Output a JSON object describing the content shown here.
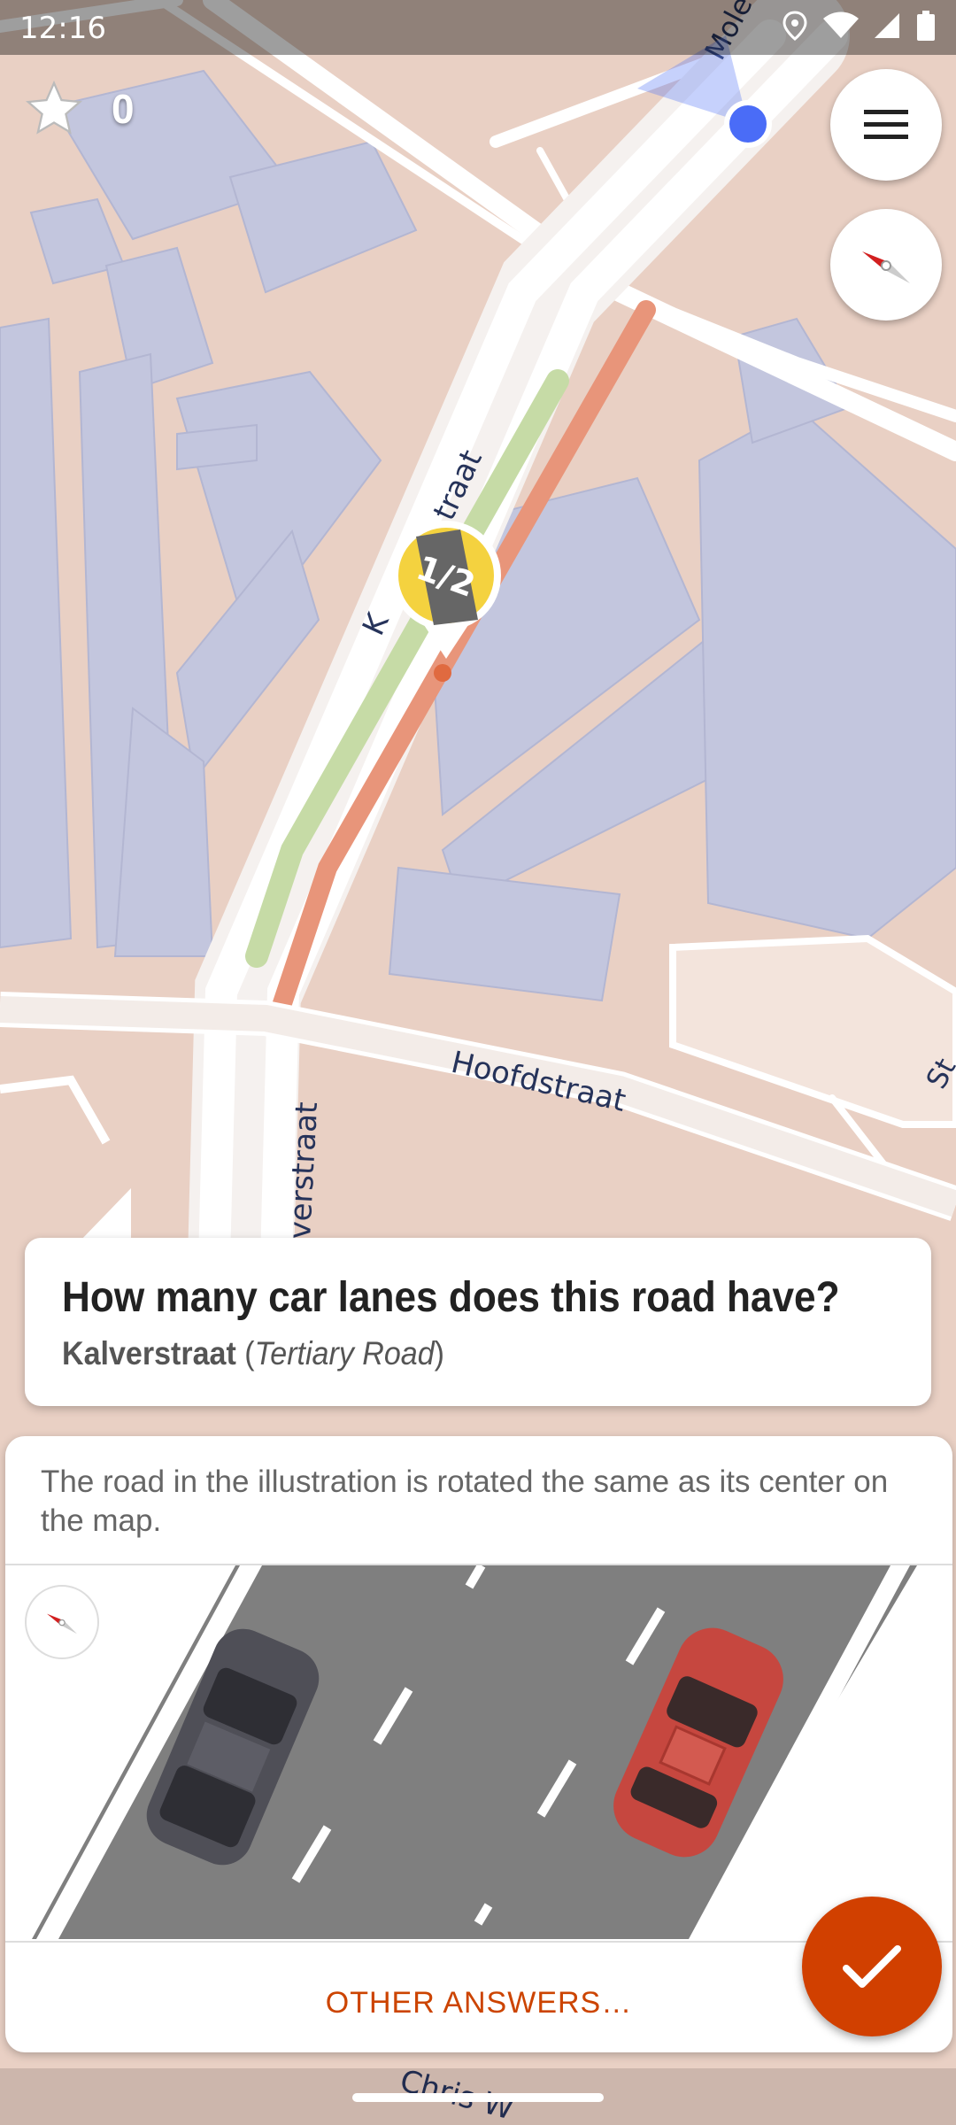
{
  "status_bar": {
    "time": "12:16",
    "icons": [
      "location-icon",
      "wifi-icon",
      "signal-icon",
      "battery-icon"
    ]
  },
  "map": {
    "streets": [
      "Kalverstraat",
      "Hoofdstraat",
      "Molenstraat",
      "Chris W"
    ],
    "label_k1": "K",
    "label_k2": "traat",
    "label_hoofd": "Hoofdstraat",
    "label_kalver_bottom": "verstraat",
    "label_mole": "Mole",
    "label_st": "St",
    "label_chris": "Chris W",
    "quest_pin_text": "1/2",
    "colors": {
      "land": "#e9d0c4",
      "building": "#c3c6de",
      "road": "#ffffff",
      "highlight": "#e8957a",
      "green": "#c6dba6"
    }
  },
  "stars": {
    "count": "0",
    "icon": "star-icon"
  },
  "quest": {
    "title": "How many car lanes does this road have?",
    "road_name": "Kalverstraat",
    "road_type": "Tertiary Road",
    "paren_open": " (",
    "paren_close": ")"
  },
  "answer": {
    "hint": "The road in the illustration is rotated the same as its center on the map.",
    "other_answers": "OTHER ANSWERS…"
  },
  "colors": {
    "accent": "#d14000",
    "text_accent": "#cc4400",
    "card_bg": "#ffffff"
  }
}
